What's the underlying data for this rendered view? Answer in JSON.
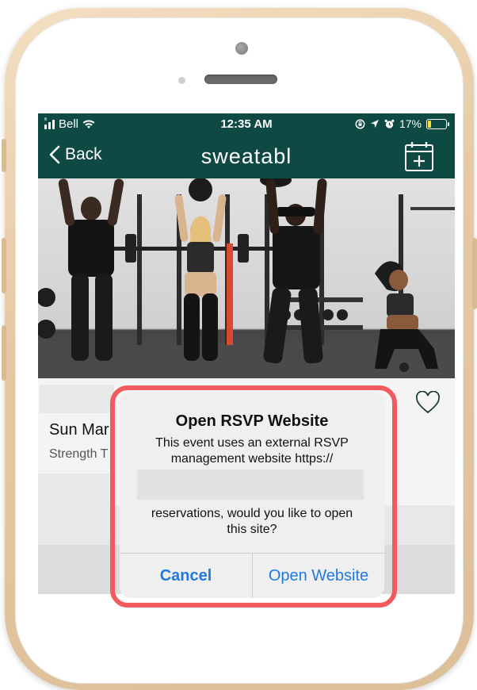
{
  "status_bar": {
    "carrier": "Bell",
    "time": "12:35 AM",
    "battery": "17%",
    "battery_level": 0.17
  },
  "nav": {
    "back_label": "Back",
    "title": "sweatabl",
    "calendar_icon": "calendar-add-icon"
  },
  "event": {
    "title": "Sun Mar",
    "subtitle": "Strength T",
    "favorite_icon": "heart-icon"
  },
  "alert": {
    "title": "Open RSVP Website",
    "message_line1": "This event uses an external RSVP",
    "message_line2": "management website https://",
    "message_line3": "reservations, would you like to open",
    "message_line4": "this site?",
    "cancel_label": "Cancel",
    "confirm_label": "Open Website"
  },
  "colors": {
    "nav_bg": "#0e4a43",
    "alert_highlight": "#f15a5e",
    "button_text": "#1f7ae0"
  }
}
